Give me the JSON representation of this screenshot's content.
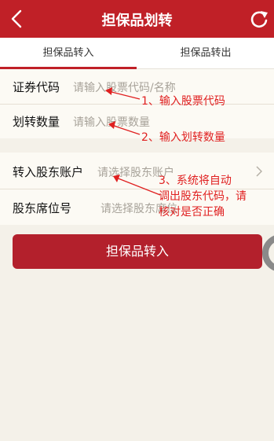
{
  "header": {
    "title": "担保品划转",
    "back_icon": "back-arrow-icon",
    "refresh_icon": "refresh-icon"
  },
  "tabs": [
    {
      "label": "担保品转入",
      "active": true
    },
    {
      "label": "担保品转出",
      "active": false
    }
  ],
  "form": {
    "security_code": {
      "label": "证券代码",
      "placeholder": "请输入股票代码/名称"
    },
    "transfer_qty": {
      "label": "划转数量",
      "placeholder": "请输入股票数量"
    },
    "shareholder_account": {
      "label": "转入股东账户",
      "placeholder": "请选择股东账户"
    },
    "seat_number": {
      "label": "股东席位号",
      "placeholder": "请选择股东席位"
    }
  },
  "submit_label": "担保品转入",
  "annotations": {
    "a1": "1、输入股票代码",
    "a2": "2、输入划转数量",
    "a3_line1": "3、系统将自动",
    "a3_line2": "调出股东代码，请",
    "a3_line3": "核对是否正确"
  },
  "colors": {
    "primary": "#c02027",
    "button": "#b3202c",
    "annotation": "#e02020",
    "background": "#f4f1e9"
  }
}
